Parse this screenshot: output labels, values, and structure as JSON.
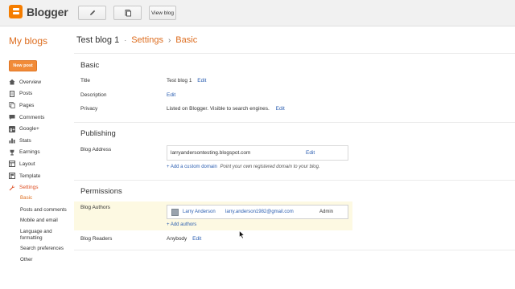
{
  "app": {
    "name": "Blogger"
  },
  "toolbar": {
    "edit_icon": "pencil-icon",
    "posts_icon": "copy-icon",
    "view_blog_label": "View blog"
  },
  "sidebar": {
    "title": "My blogs",
    "new_post_label": "New post",
    "items": [
      {
        "label": "Overview",
        "icon": "home-icon"
      },
      {
        "label": "Posts",
        "icon": "document-icon"
      },
      {
        "label": "Pages",
        "icon": "pages-icon"
      },
      {
        "label": "Comments",
        "icon": "comment-icon"
      },
      {
        "label": "Google+",
        "icon": "google-plus-icon"
      },
      {
        "label": "Stats",
        "icon": "stats-icon"
      },
      {
        "label": "Earnings",
        "icon": "trophy-icon"
      },
      {
        "label": "Layout",
        "icon": "layout-icon"
      },
      {
        "label": "Template",
        "icon": "template-icon"
      },
      {
        "label": "Settings",
        "icon": "wrench-icon"
      }
    ],
    "settings_sub": [
      {
        "label": "Basic"
      },
      {
        "label": "Posts and comments"
      },
      {
        "label": "Mobile and email"
      },
      {
        "label": "Language and formatting"
      },
      {
        "label": "Search preferences"
      },
      {
        "label": "Other"
      }
    ]
  },
  "breadcrumb": {
    "blog": "Test blog 1",
    "dot": "·",
    "settings": "Settings",
    "sep": "›",
    "current": "Basic"
  },
  "basic": {
    "title": "Basic",
    "title_label": "Title",
    "title_value": "Test blog 1",
    "title_edit": "Edit",
    "description_label": "Description",
    "description_edit": "Edit",
    "privacy_label": "Privacy",
    "privacy_value": "Listed on Blogger. Visible to search engines.",
    "privacy_edit": "Edit"
  },
  "publishing": {
    "title": "Publishing",
    "address_label": "Blog Address",
    "address_value": "larryandersontesting.blogspot.com",
    "address_edit": "Edit",
    "custom_domain_link": "+ Add a custom domain",
    "custom_domain_hint": "Point your own registered domain to your blog."
  },
  "permissions": {
    "title": "Permissions",
    "authors_label": "Blog Authors",
    "author_name": "Larry Anderson",
    "author_email": "larry.anderson1982@gmail.com",
    "author_role": "Admin",
    "add_authors": "+ Add authors",
    "readers_label": "Blog Readers",
    "readers_value": "Anybody",
    "readers_edit": "Edit"
  },
  "colors": {
    "accent": "#dd6d1f",
    "link": "#2a5db0",
    "button": "#f18b38",
    "highlight": "#fdf9e2"
  }
}
